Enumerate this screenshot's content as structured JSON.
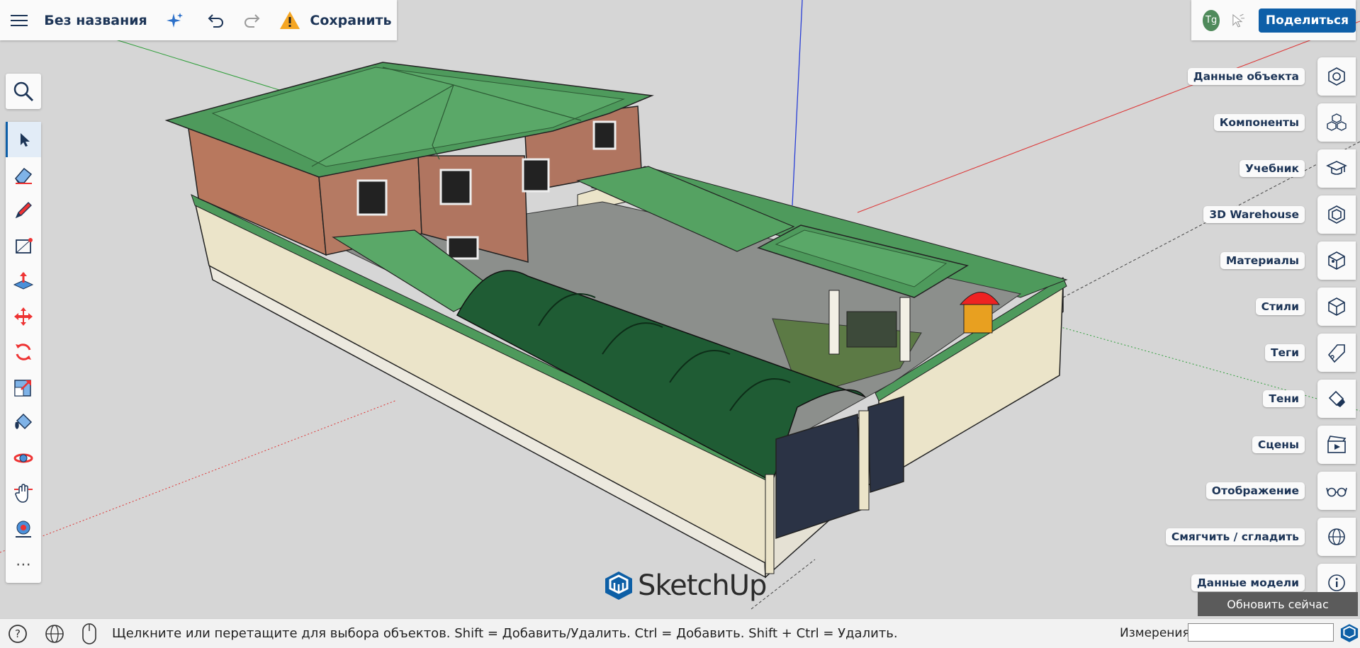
{
  "header": {
    "menu_icon": "hamburger-icon",
    "title": "Без названия",
    "save_label": "Сохранить",
    "warning_icon": "warning-icon"
  },
  "account": {
    "avatar_initials": "Tg",
    "share_label": "Поделиться"
  },
  "tools": [
    {
      "name": "select-tool",
      "icon": "arrow-icon"
    },
    {
      "name": "eraser-tool",
      "icon": "eraser-icon"
    },
    {
      "name": "pencil-tool",
      "icon": "pencil-icon"
    },
    {
      "name": "rectangle-tool",
      "icon": "rectangle-icon"
    },
    {
      "name": "push-pull-tool",
      "icon": "push-pull-icon"
    },
    {
      "name": "move-tool",
      "icon": "move-icon"
    },
    {
      "name": "rotate-tool",
      "icon": "rotate-icon"
    },
    {
      "name": "scale-tool",
      "icon": "scale-icon"
    },
    {
      "name": "paint-tool",
      "icon": "paint-bucket-icon"
    },
    {
      "name": "orbit-tool",
      "icon": "orbit-icon"
    },
    {
      "name": "pan-tool",
      "icon": "hand-icon"
    },
    {
      "name": "tape-tool",
      "icon": "tape-icon"
    }
  ],
  "panels": [
    {
      "label": "Данные объекта",
      "icon": "entity-info-icon"
    },
    {
      "label": "Компоненты",
      "icon": "components-icon"
    },
    {
      "label": "Учебник",
      "icon": "graduation-cap-icon"
    },
    {
      "label": "3D Warehouse",
      "icon": "warehouse-icon"
    },
    {
      "label": "Материалы",
      "icon": "materials-icon"
    },
    {
      "label": "Стили",
      "icon": "styles-icon"
    },
    {
      "label": "Теги",
      "icon": "tag-icon"
    },
    {
      "label": "Тени",
      "icon": "shadows-icon"
    },
    {
      "label": "Сцены",
      "icon": "scenes-icon"
    },
    {
      "label": "Отображение",
      "icon": "glasses-icon"
    },
    {
      "label": "Смягчить / сгладить",
      "icon": "soften-icon"
    },
    {
      "label": "Данные модели",
      "icon": "info-icon"
    }
  ],
  "update_label": "Обновить сейчас",
  "brand": "SketchUp",
  "status": {
    "hint": "Щелкните или перетащите для выбора объектов. Shift = Добавить/Удалить. Ctrl = Добавить. Shift + Ctrl = Удалить.",
    "measurements_label": "Измерения",
    "measurements_value": ""
  }
}
